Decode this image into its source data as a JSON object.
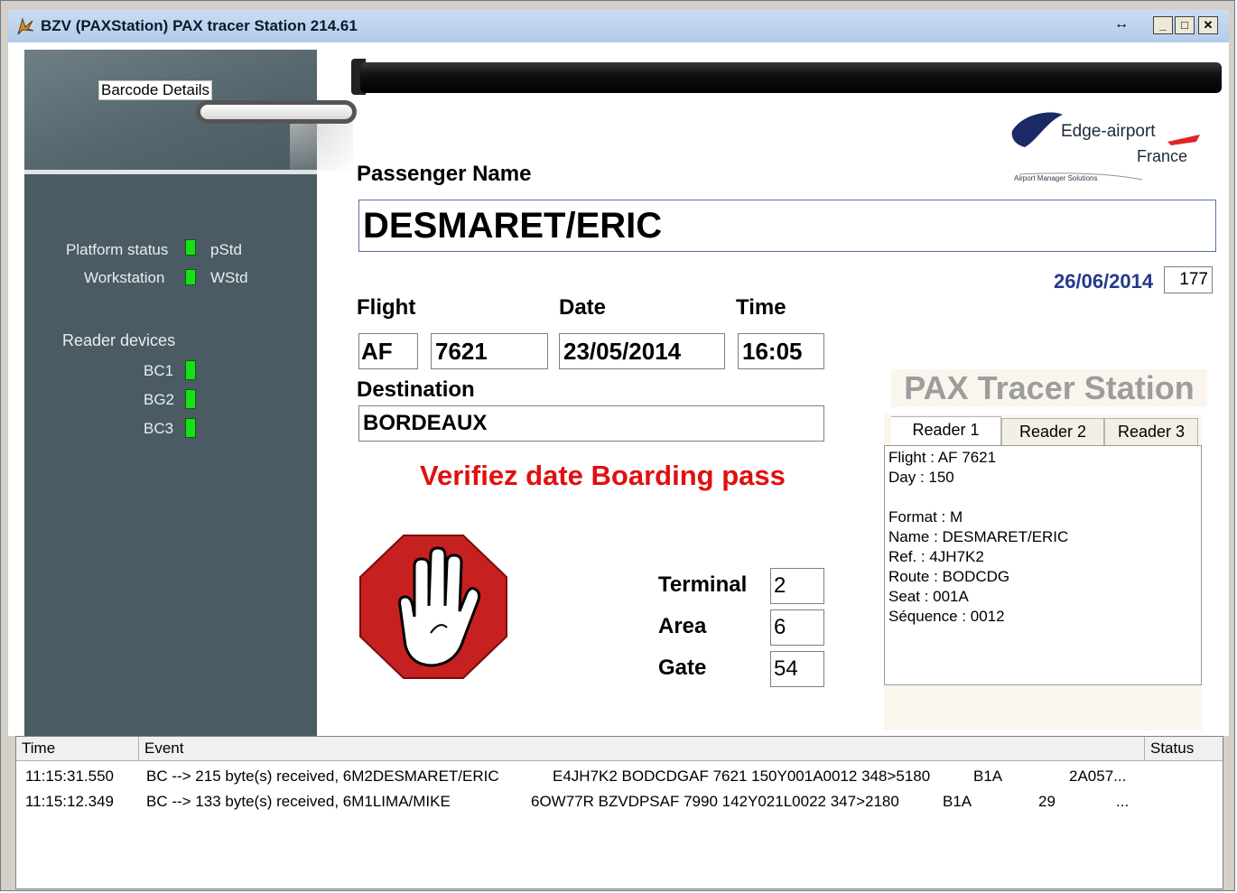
{
  "window": {
    "title": "BZV  (PAXStation) PAX tracer Station 214.61",
    "buttons": {
      "resize": "↔",
      "minimize": "_",
      "maximize": "□",
      "close": "✕"
    }
  },
  "left_panel": {
    "barcode_details": "Barcode Details",
    "platform_status_label": "Platform status",
    "platform_status_code": "pStd",
    "workstation_label": "Workstation",
    "workstation_code": "WStd",
    "reader_devices_label": "Reader devices",
    "readers": [
      "BC1",
      "BG2",
      "BC3"
    ],
    "status_color": "#18e018"
  },
  "logo": {
    "line1": "Edge-airport",
    "line2": "France",
    "tagline": "Airport Manager Solutions"
  },
  "passenger": {
    "name_label": "Passenger Name",
    "name": "DESMARET/ERIC",
    "current_date": "26/06/2014",
    "counter": "177"
  },
  "flight": {
    "flight_label": "Flight",
    "date_label": "Date",
    "time_label": "Time",
    "airline": "AF",
    "number": "7621",
    "date": "23/05/2014",
    "time": "16:05",
    "destination_label": "Destination",
    "destination": "BORDEAUX"
  },
  "warning": {
    "text": "Verifiez date Boarding pass",
    "color": "#e01010"
  },
  "location": {
    "terminal_label": "Terminal",
    "terminal": "2",
    "area_label": "Area",
    "area": "6",
    "gate_label": "Gate",
    "gate": "54"
  },
  "station": {
    "title": "PAX Tracer Station",
    "tabs": [
      "Reader 1",
      "Reader 2",
      "Reader 3"
    ],
    "active_tab": "Reader 1",
    "reader_lines": [
      "Flight : AF 7621",
      "Day : 150",
      "",
      "Format : M",
      "Name : DESMARET/ERIC",
      "Ref. : 4JH7K2",
      "Route : BODCDG",
      "Seat : 001A",
      "Séquence : 0012"
    ]
  },
  "events": {
    "columns": [
      "Time",
      "Event",
      "Status"
    ],
    "rows": [
      {
        "time": "11:15:31.550",
        "event": "BC --> 215 byte(s) received, 6M2DESMARET/ERIC",
        "data": "E4JH7K2 BODCDGAF 7621 150Y001A0012 348>5180",
        "code": "B1A",
        "extra": "2A057..."
      },
      {
        "time": "11:15:12.349",
        "event": "BC --> 133 byte(s) received, 6M1LIMA/MIKE",
        "data": "6OW77R BZVDPSAF 7990 142Y021L0022 347>2180",
        "code": "B1A",
        "extra": "29",
        "extra2": "..."
      }
    ]
  }
}
